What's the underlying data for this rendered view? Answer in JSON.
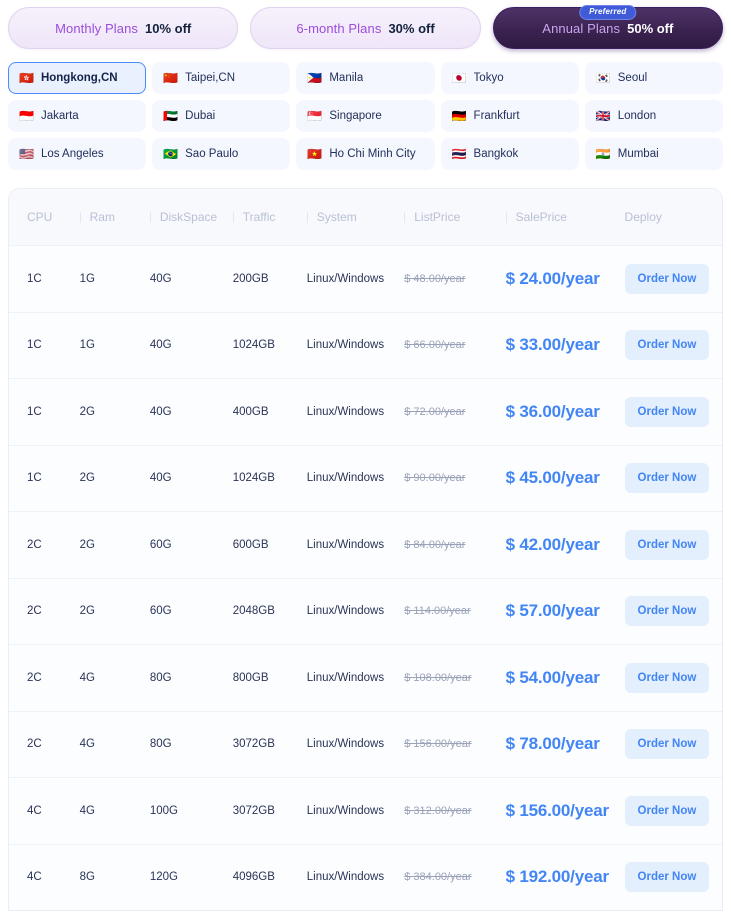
{
  "plan_tabs": [
    {
      "name": "Monthly Plans",
      "discount": "10% off",
      "active": false,
      "badge": null
    },
    {
      "name": "6-month Plans",
      "discount": "30% off",
      "active": false,
      "badge": null
    },
    {
      "name": "Annual Plans",
      "discount": "50% off",
      "active": true,
      "badge": "Preferred"
    }
  ],
  "locations": [
    {
      "flag": "🇭🇰",
      "name": "Hongkong,CN",
      "selected": true
    },
    {
      "flag": "🇨🇳",
      "name": "Taipei,CN",
      "selected": false
    },
    {
      "flag": "🇵🇭",
      "name": "Manila",
      "selected": false
    },
    {
      "flag": "🇯🇵",
      "name": "Tokyo",
      "selected": false
    },
    {
      "flag": "🇰🇷",
      "name": "Seoul",
      "selected": false
    },
    {
      "flag": "🇮🇩",
      "name": "Jakarta",
      "selected": false
    },
    {
      "flag": "🇦🇪",
      "name": "Dubai",
      "selected": false
    },
    {
      "flag": "🇸🇬",
      "name": "Singapore",
      "selected": false
    },
    {
      "flag": "🇩🇪",
      "name": "Frankfurt",
      "selected": false
    },
    {
      "flag": "🇬🇧",
      "name": "London",
      "selected": false
    },
    {
      "flag": "🇺🇸",
      "name": "Los Angeles",
      "selected": false
    },
    {
      "flag": "🇧🇷",
      "name": "Sao Paulo",
      "selected": false
    },
    {
      "flag": "🇻🇳",
      "name": "Ho Chi Minh City",
      "selected": false
    },
    {
      "flag": "🇹🇭",
      "name": "Bangkok",
      "selected": false
    },
    {
      "flag": "🇮🇳",
      "name": "Mumbai",
      "selected": false
    }
  ],
  "table": {
    "headers": {
      "cpu": "CPU",
      "ram": "Ram",
      "diskspace": "DiskSpace",
      "traffic": "Traffic",
      "system": "System",
      "listprice": "ListPrice",
      "saleprice": "SalePrice",
      "deploy": "Deploy"
    },
    "order_button_label": "Order Now",
    "rows": [
      {
        "cpu": "1C",
        "ram": "1G",
        "diskspace": "40G",
        "traffic": "200GB",
        "system": "Linux/Windows",
        "listprice": "$ 48.00/year",
        "saleprice": "$ 24.00/year"
      },
      {
        "cpu": "1C",
        "ram": "1G",
        "diskspace": "40G",
        "traffic": "1024GB",
        "system": "Linux/Windows",
        "listprice": "$ 66.00/year",
        "saleprice": "$ 33.00/year"
      },
      {
        "cpu": "1C",
        "ram": "2G",
        "diskspace": "40G",
        "traffic": "400GB",
        "system": "Linux/Windows",
        "listprice": "$ 72.00/year",
        "saleprice": "$ 36.00/year"
      },
      {
        "cpu": "1C",
        "ram": "2G",
        "diskspace": "40G",
        "traffic": "1024GB",
        "system": "Linux/Windows",
        "listprice": "$ 90.00/year",
        "saleprice": "$ 45.00/year"
      },
      {
        "cpu": "2C",
        "ram": "2G",
        "diskspace": "60G",
        "traffic": "600GB",
        "system": "Linux/Windows",
        "listprice": "$ 84.00/year",
        "saleprice": "$ 42.00/year"
      },
      {
        "cpu": "2C",
        "ram": "2G",
        "diskspace": "60G",
        "traffic": "2048GB",
        "system": "Linux/Windows",
        "listprice": "$ 114.00/year",
        "saleprice": "$ 57.00/year"
      },
      {
        "cpu": "2C",
        "ram": "4G",
        "diskspace": "80G",
        "traffic": "800GB",
        "system": "Linux/Windows",
        "listprice": "$ 108.00/year",
        "saleprice": "$ 54.00/year"
      },
      {
        "cpu": "2C",
        "ram": "4G",
        "diskspace": "80G",
        "traffic": "3072GB",
        "system": "Linux/Windows",
        "listprice": "$ 156.00/year",
        "saleprice": "$ 78.00/year"
      },
      {
        "cpu": "4C",
        "ram": "4G",
        "diskspace": "100G",
        "traffic": "3072GB",
        "system": "Linux/Windows",
        "listprice": "$ 312.00/year",
        "saleprice": "$ 156.00/year"
      },
      {
        "cpu": "4C",
        "ram": "8G",
        "diskspace": "120G",
        "traffic": "4096GB",
        "system": "Linux/Windows",
        "listprice": "$ 384.00/year",
        "saleprice": "$ 192.00/year"
      }
    ]
  },
  "colors": {
    "accent_blue": "#4285f4",
    "selected_chip_bg": "#e8f1fd",
    "selected_chip_border": "#4b8df8",
    "active_tab_purple": "#3b2350",
    "tab_name_purple": "#9b4ddb",
    "badge_blue": "#3f5bd8"
  }
}
